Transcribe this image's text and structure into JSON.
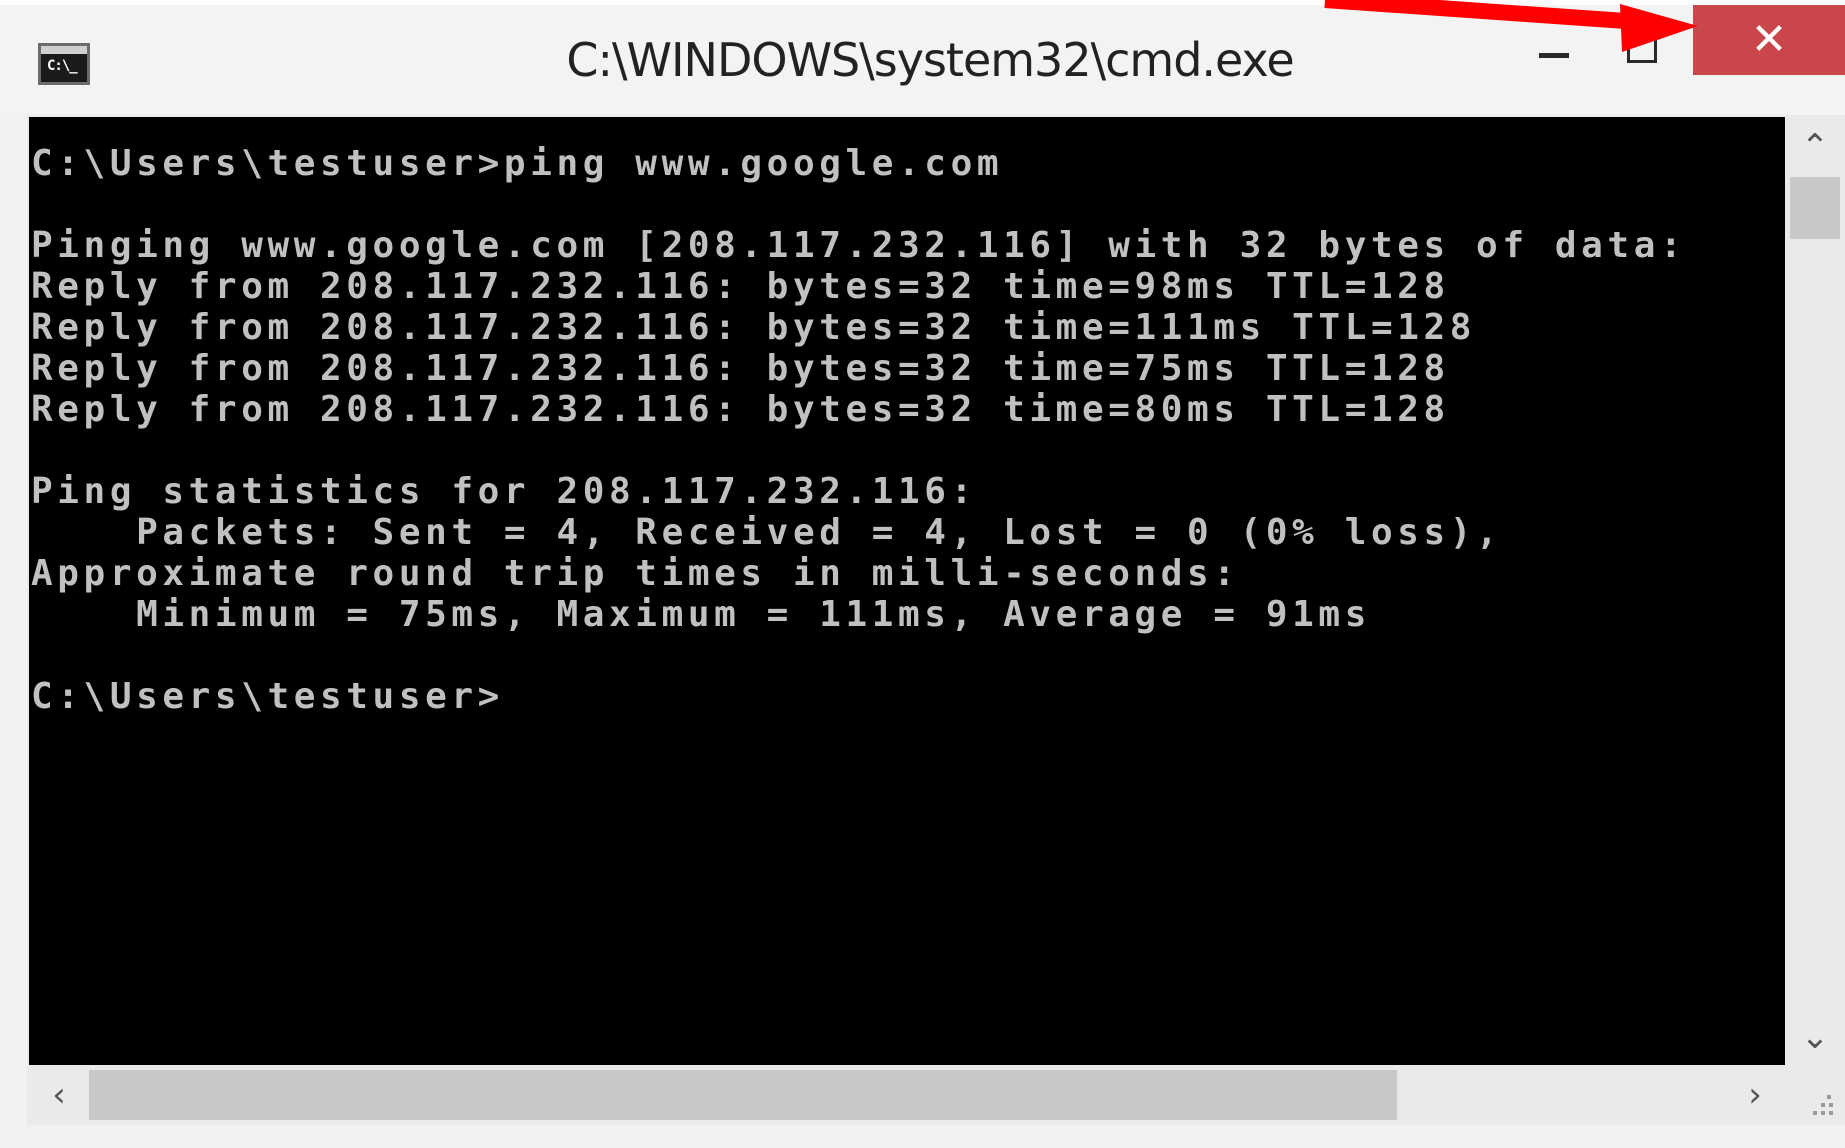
{
  "window": {
    "title": "C:\\WINDOWS\\system32\\cmd.exe",
    "icon_label": "C:\\_",
    "icon": "console-icon",
    "controls": {
      "minimize_icon": "minimize-icon",
      "maximize_icon": "maximize-icon",
      "close_glyph": "✕",
      "close_color": "#c9474b"
    }
  },
  "console": {
    "background": "#000000",
    "foreground": "#c0c0c0",
    "lines": [
      "C:\\Users\\testuser>ping www.google.com",
      "",
      "Pinging www.google.com [208.117.232.116] with 32 bytes of data:",
      "Reply from 208.117.232.116: bytes=32 time=98ms TTL=128",
      "Reply from 208.117.232.116: bytes=32 time=111ms TTL=128",
      "Reply from 208.117.232.116: bytes=32 time=75ms TTL=128",
      "Reply from 208.117.232.116: bytes=32 time=80ms TTL=128",
      "",
      "Ping statistics for 208.117.232.116:",
      "    Packets: Sent = 4, Received = 4, Lost = 0 (0% loss),",
      "Approximate round trip times in milli-seconds:",
      "    Minimum = 75ms, Maximum = 111ms, Average = 91ms",
      "",
      "C:\\Users\\testuser>"
    ]
  },
  "scrollbars": {
    "vertical": {
      "up_glyph": "⌃",
      "down_glyph": "⌄"
    },
    "horizontal": {
      "left_glyph": "‹",
      "right_glyph": "›"
    }
  },
  "annotation": {
    "arrow_color": "#ff0000"
  }
}
